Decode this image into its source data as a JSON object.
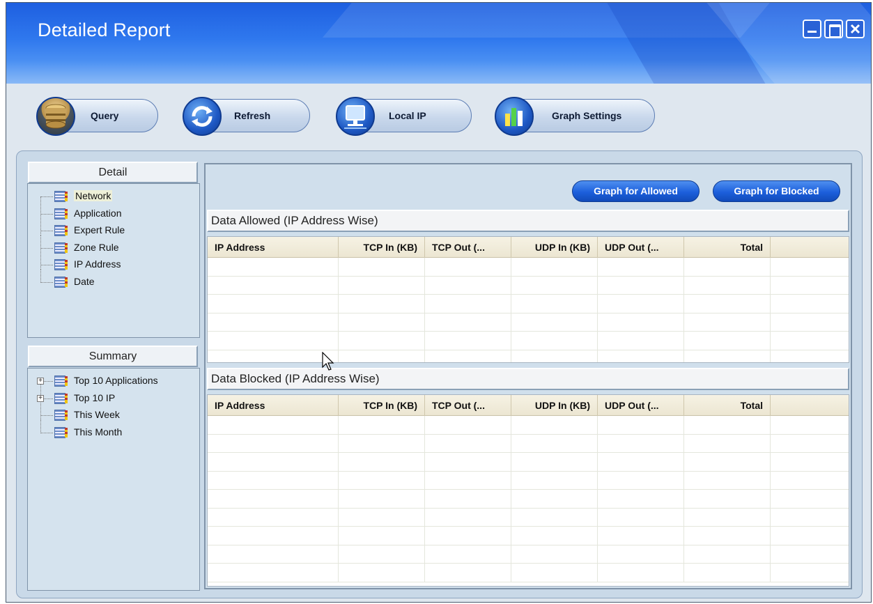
{
  "window": {
    "title": "Detailed Report",
    "controls": [
      "minimize-icon",
      "maximize-icon",
      "close-icon"
    ]
  },
  "toolbar": {
    "query_label": "Query",
    "refresh_label": "Refresh",
    "local_ip_label": "Local IP",
    "graph_settings_label": "Graph Settings"
  },
  "detail": {
    "header": "Detail",
    "items": [
      "Network",
      "Application",
      "Expert Rule",
      "Zone Rule",
      "IP Address",
      "Date"
    ],
    "selected": "Network"
  },
  "summary": {
    "header": "Summary",
    "items": [
      "Top 10 Applications",
      "Top 10 IP",
      "This Week",
      "This Month"
    ]
  },
  "graph_buttons": {
    "allowed": "Graph for Allowed",
    "blocked": "Graph for Blocked"
  },
  "allowed_table": {
    "title": "Data Allowed (IP Address Wise)",
    "columns": [
      "IP Address",
      "TCP In (KB)",
      "TCP Out (...",
      "UDP In (KB)",
      "UDP Out (...",
      "Total"
    ]
  },
  "blocked_table": {
    "title": "Data Blocked (IP Address Wise)",
    "columns": [
      "IP Address",
      "TCP In (KB)",
      "TCP Out (...",
      "UDP In (KB)",
      "UDP Out (...",
      "Total"
    ]
  }
}
